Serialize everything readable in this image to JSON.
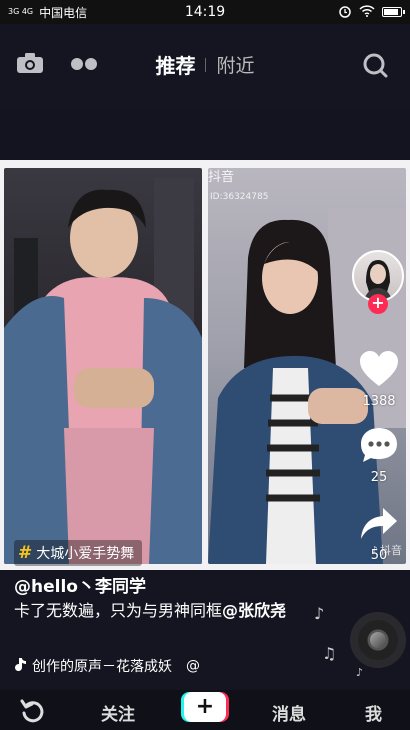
{
  "status_bar": {
    "signal": "3G 4G",
    "carrier": "中国电信",
    "time": "14:19",
    "battery_level": 0.85
  },
  "top_nav": {
    "tabs": [
      {
        "label": "推荐",
        "active": true
      },
      {
        "label": "附近",
        "active": false
      }
    ]
  },
  "video": {
    "watermark": "抖音",
    "watermark_id": "ID:36324785",
    "watermark_small": "抖音",
    "topic": "大城小爱手势舞"
  },
  "actions": {
    "likes": "1388",
    "comments": "25",
    "shares": "50"
  },
  "caption": {
    "author": "@hello丶李同学",
    "description": "卡了无数遍，只为与男神同框",
    "mention": "@张欣尧",
    "music": "创作的原声－花落成妖",
    "music_extra": "@"
  },
  "bottom_nav": {
    "home_icon": "refresh-icon",
    "follow": "关注",
    "create": "+",
    "messages": "消息",
    "me": "我"
  },
  "colors": {
    "accent_red": "#fe2c55",
    "accent_cyan": "#25f4ee",
    "topic_yellow": "#f7c51a",
    "background": "#141520"
  }
}
